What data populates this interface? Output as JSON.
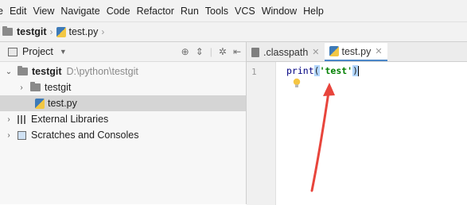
{
  "menu": {
    "items": [
      "e",
      "Edit",
      "View",
      "Navigate",
      "Code",
      "Refactor",
      "Run",
      "Tools",
      "VCS",
      "Window",
      "Help"
    ]
  },
  "breadcrumb": {
    "project": "testgit",
    "file": "test.py"
  },
  "project_panel": {
    "title": "Project",
    "tree": [
      {
        "label": "testgit",
        "path": "D:\\python\\testgit"
      },
      {
        "label": "testgit"
      },
      {
        "label": "test.py"
      },
      {
        "label": "External Libraries"
      },
      {
        "label": "Scratches and Consoles"
      }
    ]
  },
  "editor": {
    "tabs": [
      {
        "label": ".classpath"
      },
      {
        "label": "test.py"
      }
    ],
    "line_number": "1",
    "code": {
      "func": "print",
      "open_paren": "(",
      "string": "'test'",
      "close_paren": ")"
    }
  },
  "colors": {
    "annotation_arrow": "#e8453c",
    "tab_accent": "#4a86c8"
  }
}
